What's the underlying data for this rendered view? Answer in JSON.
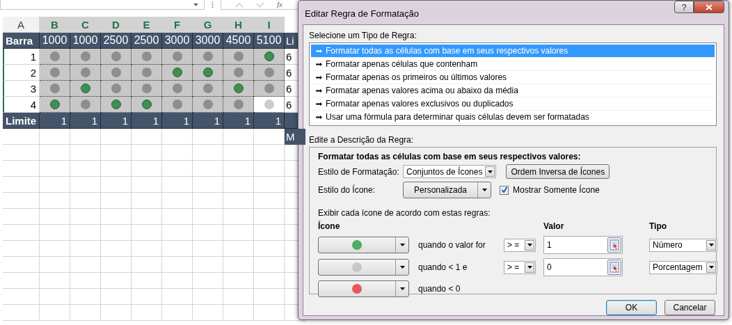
{
  "formula_bar": {
    "function_label": "fx"
  },
  "sheet": {
    "columns": [
      {
        "label": "A",
        "selected": false
      },
      {
        "label": "B",
        "selected": true
      },
      {
        "label": "C",
        "selected": true
      },
      {
        "label": "D",
        "selected": true
      },
      {
        "label": "E",
        "selected": true
      },
      {
        "label": "F",
        "selected": true
      },
      {
        "label": "G",
        "selected": true
      },
      {
        "label": "H",
        "selected": true
      },
      {
        "label": "I",
        "selected": true
      }
    ],
    "header_row": {
      "label": "Barra",
      "values": [
        "1000",
        "1000",
        "2500",
        "2500",
        "3000",
        "3000",
        "4500",
        "5100"
      ],
      "cut_text": "Li"
    },
    "rows": [
      {
        "label": "1",
        "cut_text": "6",
        "cells": [
          {
            "kind": "gray",
            "selected": false
          },
          {
            "kind": "gray",
            "selected": false
          },
          {
            "kind": "gray",
            "selected": false
          },
          {
            "kind": "gray",
            "selected": false
          },
          {
            "kind": "gray",
            "selected": false
          },
          {
            "kind": "gray",
            "selected": false
          },
          {
            "kind": "gray",
            "selected": false
          },
          {
            "kind": "green",
            "selected": false
          }
        ]
      },
      {
        "label": "2",
        "cut_text": "6",
        "cells": [
          {
            "kind": "gray",
            "selected": false
          },
          {
            "kind": "gray",
            "selected": false
          },
          {
            "kind": "gray",
            "selected": false
          },
          {
            "kind": "gray",
            "selected": false
          },
          {
            "kind": "green",
            "selected": false
          },
          {
            "kind": "green",
            "selected": false
          },
          {
            "kind": "gray",
            "selected": false
          },
          {
            "kind": "gray",
            "selected": false
          }
        ]
      },
      {
        "label": "3",
        "cut_text": "6",
        "cells": [
          {
            "kind": "gray",
            "selected": false
          },
          {
            "kind": "green",
            "selected": false
          },
          {
            "kind": "gray",
            "selected": false
          },
          {
            "kind": "gray",
            "selected": false
          },
          {
            "kind": "gray",
            "selected": false
          },
          {
            "kind": "gray",
            "selected": false
          },
          {
            "kind": "green",
            "selected": false
          },
          {
            "kind": "gray",
            "selected": false
          }
        ]
      },
      {
        "label": "4",
        "cut_text": "6",
        "cells": [
          {
            "kind": "green",
            "selected": false
          },
          {
            "kind": "gray",
            "selected": false
          },
          {
            "kind": "green",
            "selected": false
          },
          {
            "kind": "green",
            "selected": false
          },
          {
            "kind": "gray",
            "selected": false
          },
          {
            "kind": "gray",
            "selected": false
          },
          {
            "kind": "gray",
            "selected": false
          },
          {
            "kind": "gray",
            "selected": true
          }
        ]
      }
    ],
    "limit_row": {
      "label": "Limite",
      "values": [
        "1",
        "1",
        "1",
        "1",
        "1",
        "1",
        "1",
        "1"
      ]
    },
    "below_cut_text": "M"
  },
  "dialog": {
    "title": "Editar Regra de Formatação",
    "help": "?",
    "rule_type_label": "Selecione um Tipo de Regra:",
    "rule_types": [
      {
        "label": "Formatar todas as células com base em seus respectivos valores",
        "selected": true
      },
      {
        "label": "Formatar apenas células que contenham",
        "selected": false
      },
      {
        "label": "Formatar apenas os primeiros ou últimos valores",
        "selected": false
      },
      {
        "label": "Formatar apenas valores acima ou abaixo da média",
        "selected": false
      },
      {
        "label": "Formatar apenas valores exclusivos ou duplicados",
        "selected": false
      },
      {
        "label": "Usar uma fórmula para determinar quais células devem ser formatadas",
        "selected": false
      }
    ],
    "description_label": "Edite a Descrição da Regra:",
    "description_heading": "Formatar todas as células com base em seus respectivos valores:",
    "format_style": {
      "label": "Estilo de Formatação:",
      "value": "Conjuntos de Ícones"
    },
    "reverse_button": "Ordem Inversa de Ícones",
    "icon_style": {
      "label": "Estilo do Ícone:",
      "value": "Personalizada"
    },
    "show_icon_only": {
      "label": "Mostrar Somente Ícone",
      "checked": true
    },
    "rules_caption": "Exibir cada ícone de acordo com estas regras:",
    "headings": {
      "icon": "Ícone",
      "value": "Valor",
      "type": "Tipo"
    },
    "icon_rules": [
      {
        "color": "#4caf5e",
        "condition": "quando o valor for",
        "operator": "> =",
        "value": "1",
        "type": "Número"
      },
      {
        "color": "#c8c8c8",
        "condition": "quando < 1 e",
        "operator": "> =",
        "value": "0",
        "type": "Porcentagem"
      },
      {
        "color": "#e8585a",
        "condition": "quando < 0"
      }
    ],
    "buttons": [
      {
        "label": "OK",
        "default": true
      },
      {
        "label": "Cancelar",
        "default": false
      }
    ]
  }
}
